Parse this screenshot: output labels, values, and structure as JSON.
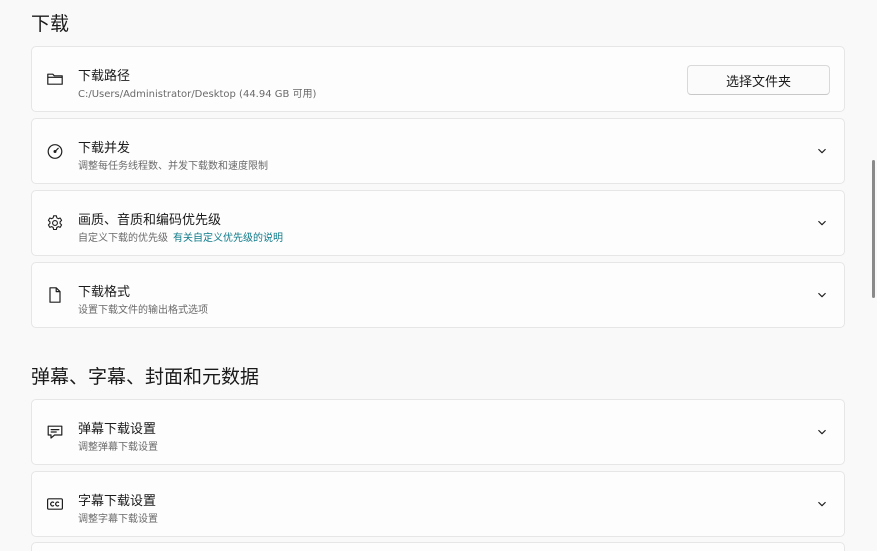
{
  "sections": {
    "download": {
      "title": "下载"
    },
    "metadata": {
      "title": "弹幕、字幕、封面和元数据"
    }
  },
  "cards": {
    "download_path": {
      "title": "下载路径",
      "desc": "C:/Users/Administrator/Desktop (44.94 GB 可用)",
      "button_label": "选择文件夹",
      "icon": "folder-icon"
    },
    "concurrency": {
      "title": "下载并发",
      "desc": "调整每任务线程数、并发下载数和速度限制",
      "icon": "speedometer-icon"
    },
    "quality_priority": {
      "title": "画质、音质和编码优先级",
      "desc": "自定义下载的优先级",
      "link": "有关自定义优先级的说明",
      "icon": "gear-icon"
    },
    "format": {
      "title": "下载格式",
      "desc": "设置下载文件的输出格式选项",
      "icon": "document-icon"
    },
    "danmaku": {
      "title": "弹幕下载设置",
      "desc": "调整弹幕下载设置",
      "icon": "chat-bubble-icon"
    },
    "subtitle": {
      "title": "字幕下载设置",
      "desc": "调整字幕下载设置",
      "icon": "closed-caption-icon"
    }
  }
}
